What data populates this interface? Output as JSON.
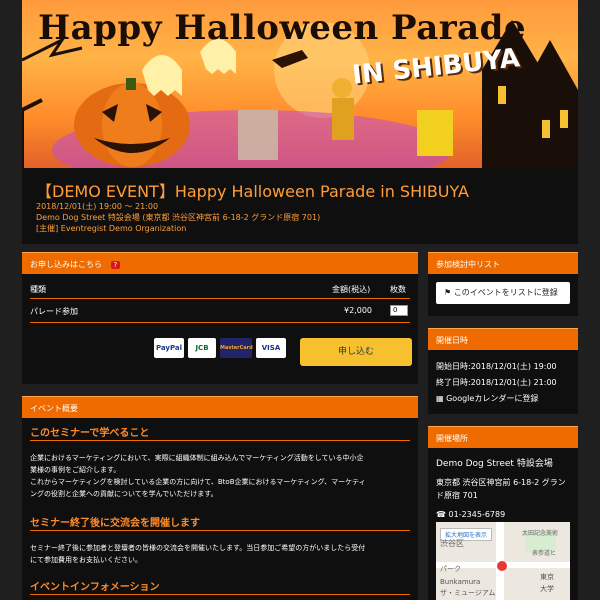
{
  "banner": {
    "title": "Happy Halloween Parade",
    "subtitle": "IN SHIBUYA"
  },
  "event": {
    "title": "【DEMO EVENT】Happy Halloween Parade in SHIBUYA",
    "datetime": "2018/12/01(土) 19:00 〜 21:00",
    "venue": "Demo Dog Street 特設会場 (東京都 渋谷区神宮前 6-18-2 グランド原宿 701)",
    "organizer": "[主催] Eventregist Demo Organization"
  },
  "apply": {
    "header": "お申し込みはこちら",
    "badge": "?",
    "col_type": "種類",
    "col_price": "金額(税込)",
    "col_qty": "枚数",
    "ticket_name": "パレード参加",
    "ticket_price": "¥2,000",
    "ticket_qty": "0",
    "cards": [
      "PayPal",
      "JCB",
      "MasterCard",
      "VISA"
    ],
    "button": "申し込む"
  },
  "overview": {
    "header": "イベント概要",
    "h1": "このセミナーで学べること",
    "p1a": "企業におけるマーケティングにおいて、実際に組織体制に組み込んでマーケティング活動をしている中小企",
    "p1b": "業様の事例をご紹介します。",
    "p1c": "これからマーケティングを検討している企業の方に向けて、BtoB企業におけるマーケティング、マーケティ",
    "p1d": "ングの役割と企業への貢献についてを学んでいただけます。",
    "h2": "セミナー終了後に交流会を開催します",
    "p2a": "セミナー終了後に参加者と登壇者の皆様の交流会を開催いたします。当日参加ご希望の方がいましたら受付",
    "p2b": "にて参加費用をお支払いください。",
    "h3": "イベントインフォメーション"
  },
  "sidebar": {
    "list_header": "参加検討中リスト",
    "list_button": "このイベントをリストに登録",
    "date_header": "開催日時",
    "start": "開始日時:2018/12/01(土) 19:00",
    "end": "終了日時:2018/12/01(土) 21:00",
    "gcal": "Googleカレンダーに登録",
    "place_header": "開催場所",
    "place_name": "Demo Dog Street 特設会場",
    "address1": "東京都 渋谷区神宮前 6-18-2 グラン",
    "address2": "ド原宿 701",
    "phone": "01-2345-6789",
    "map_button": "拡大地図を表示",
    "map_labels": [
      "渋谷区",
      "太田記念美術",
      "表参道ヒ",
      "パーク",
      "Bunkamura",
      "ザ・ミュージアム",
      "東京",
      "大学"
    ]
  },
  "colors": {
    "accent": "#ef6b00",
    "title": "#ff9d3a",
    "button": "#f7c02e"
  }
}
